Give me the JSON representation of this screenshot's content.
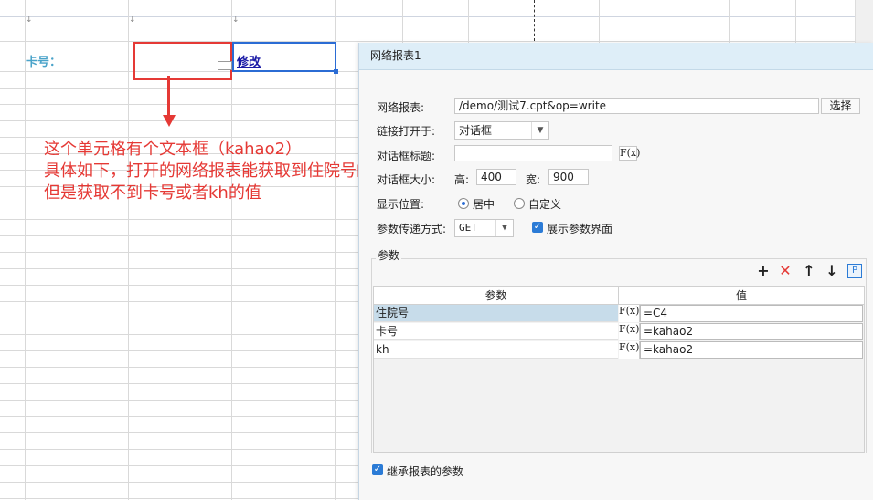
{
  "sheet": {
    "label": "卡号：",
    "link_text": "修改"
  },
  "annotation": {
    "lines": [
      "这个单元格有个文本框（kahao2）",
      "具体如下，打开的网络报表能获取到住院号的值",
      "但是获取不到卡号或者kh的值"
    ]
  },
  "dialog": {
    "title": "网络报表1",
    "report_label": "网络报表:",
    "report_value": "/demo/测试7.cpt&op=write",
    "select_button": "选择",
    "open_in_label": "链接打开于:",
    "open_in_value": "对话框",
    "dialog_title_label": "对话框标题:",
    "dialog_title_value": "",
    "dialog_size_label": "对话框大小:",
    "height_label": "高:",
    "height_value": "400",
    "width_label": "宽:",
    "width_value": "900",
    "position_label": "显示位置:",
    "position_options": [
      "居中",
      "自定义"
    ],
    "position_selected": "居中",
    "method_label": "参数传递方式:",
    "method_value": "GET",
    "show_params_label": "展示参数界面",
    "show_params_checked": true,
    "params_group_title": "参数",
    "fx_label": "F(x)",
    "columns": [
      "参数",
      "值"
    ],
    "params": [
      {
        "name": "住院号",
        "value": "=C4"
      },
      {
        "name": "卡号",
        "value": "=kahao2"
      },
      {
        "name": "kh",
        "value": "=kahao2"
      }
    ],
    "inherit_label": "继承报表的参数",
    "inherit_checked": true
  },
  "colors": {
    "accent": "#2b6cd4",
    "annotation": "#e53935",
    "label_blue": "#4aa3c9",
    "dialog_title_bg": "#deeef8",
    "selected_row": "#c7dcea"
  },
  "icons": [
    "plus-icon",
    "delete-icon",
    "move-up-icon",
    "move-down-icon",
    "parameter-icon",
    "formula-icon",
    "checkmark-icon",
    "dropdown-caret-icon"
  ]
}
